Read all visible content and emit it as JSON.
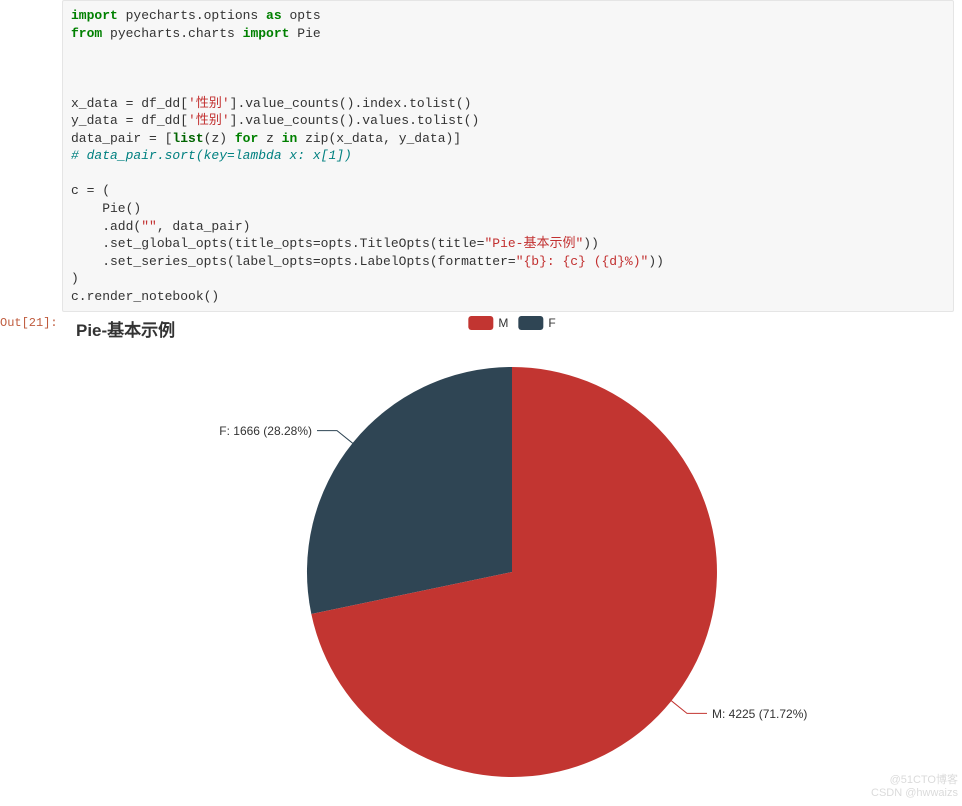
{
  "code": {
    "l1_import": "import",
    "l1_pyecharts": " pyecharts.options ",
    "l1_as": "as",
    "l1_opts": " opts",
    "l2_from": "from",
    "l2_mod": " pyecharts.charts ",
    "l2_import": "import",
    "l2_pie": " Pie",
    "l5_a": "x_data = df_dd[",
    "l5_str": "'性别'",
    "l5_b": "].value_counts().index.tolist()",
    "l6_a": "y_data = df_dd[",
    "l6_str": "'性别'",
    "l6_b": "].value_counts().values.tolist()",
    "l7_a": "data_pair = [",
    "l7_list": "list",
    "l7_b": "(z) ",
    "l7_for": "for",
    "l7_c": " z ",
    "l7_in": "in",
    "l7_d": " zip(x_data, y_data)]",
    "l8_comment": "# data_pair.sort(key=lambda x: x[1])",
    "l10": "c = (",
    "l11": "    Pie()",
    "l12_a": "    .add(",
    "l12_str": "\"\"",
    "l12_b": ", data_pair)",
    "l13_a": "    .set_global_opts(title_opts=opts.TitleOpts(title=",
    "l13_str": "\"Pie-基本示例\"",
    "l13_b": "))",
    "l14_a": "    .set_series_opts(label_opts=opts.LabelOpts(formatter=",
    "l14_str": "\"{b}: {c} ({d}%)\"",
    "l14_b": "))",
    "l15": ")",
    "l16": "c.render_notebook()"
  },
  "output": {
    "prompt": "Out[21]:",
    "chart_title": "Pie-基本示例",
    "legend_m": "M",
    "legend_f": "F",
    "label_m": "M: 4225 (71.72%)",
    "label_f": "F: 1666 (28.28%)",
    "watermark1": "@51CTO博客",
    "watermark2": "CSDN @hwwaizs"
  },
  "colors": {
    "m": "#c23531",
    "f": "#2f4554"
  },
  "chart_data": {
    "type": "pie",
    "title": "Pie-基本示例",
    "series": [
      {
        "name": "M",
        "value": 4225,
        "percent": 71.72,
        "color": "#c23531"
      },
      {
        "name": "F",
        "value": 1666,
        "percent": 28.28,
        "color": "#2f4554"
      }
    ],
    "legend_position": "top-center",
    "label_formatter": "{b}: {c} ({d}%)"
  }
}
